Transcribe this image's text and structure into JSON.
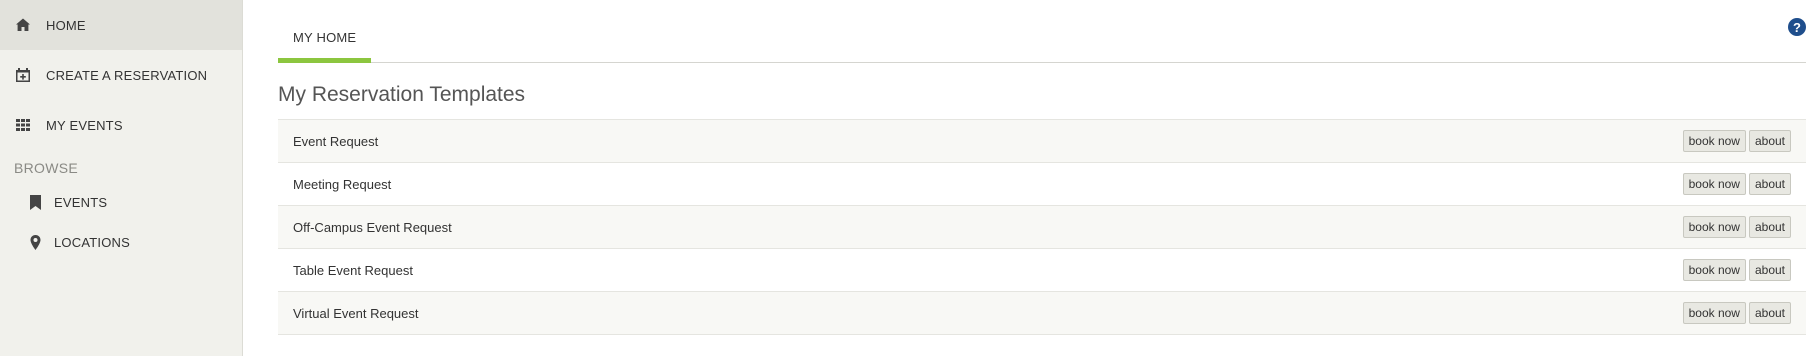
{
  "sidebar": {
    "items": [
      {
        "label": "HOME",
        "icon": "home-icon",
        "active": true
      },
      {
        "label": "CREATE A RESERVATION",
        "icon": "calendar-plus-icon"
      },
      {
        "label": "MY EVENTS",
        "icon": "grid-icon"
      }
    ],
    "browse_heading": "BROWSE",
    "browse_items": [
      {
        "label": "EVENTS",
        "icon": "bookmark-icon"
      },
      {
        "label": "LOCATIONS",
        "icon": "map-pin-icon"
      }
    ]
  },
  "main": {
    "help_icon": "?",
    "tabs": [
      {
        "label": "MY HOME",
        "active": true
      }
    ],
    "section_title": "My Reservation Templates",
    "templates": [
      {
        "name": "Event Request",
        "book_label": "book now",
        "about_label": "about"
      },
      {
        "name": "Meeting Request",
        "book_label": "book now",
        "about_label": "about"
      },
      {
        "name": "Off-Campus Event Request",
        "book_label": "book now",
        "about_label": "about"
      },
      {
        "name": "Table Event Request",
        "book_label": "book now",
        "about_label": "about"
      },
      {
        "name": "Virtual Event Request",
        "book_label": "book now",
        "about_label": "about"
      }
    ]
  },
  "colors": {
    "accent": "#8cc63f",
    "help_icon": "#1f4e8c",
    "sidebar_bg": "#f1f1ec"
  }
}
